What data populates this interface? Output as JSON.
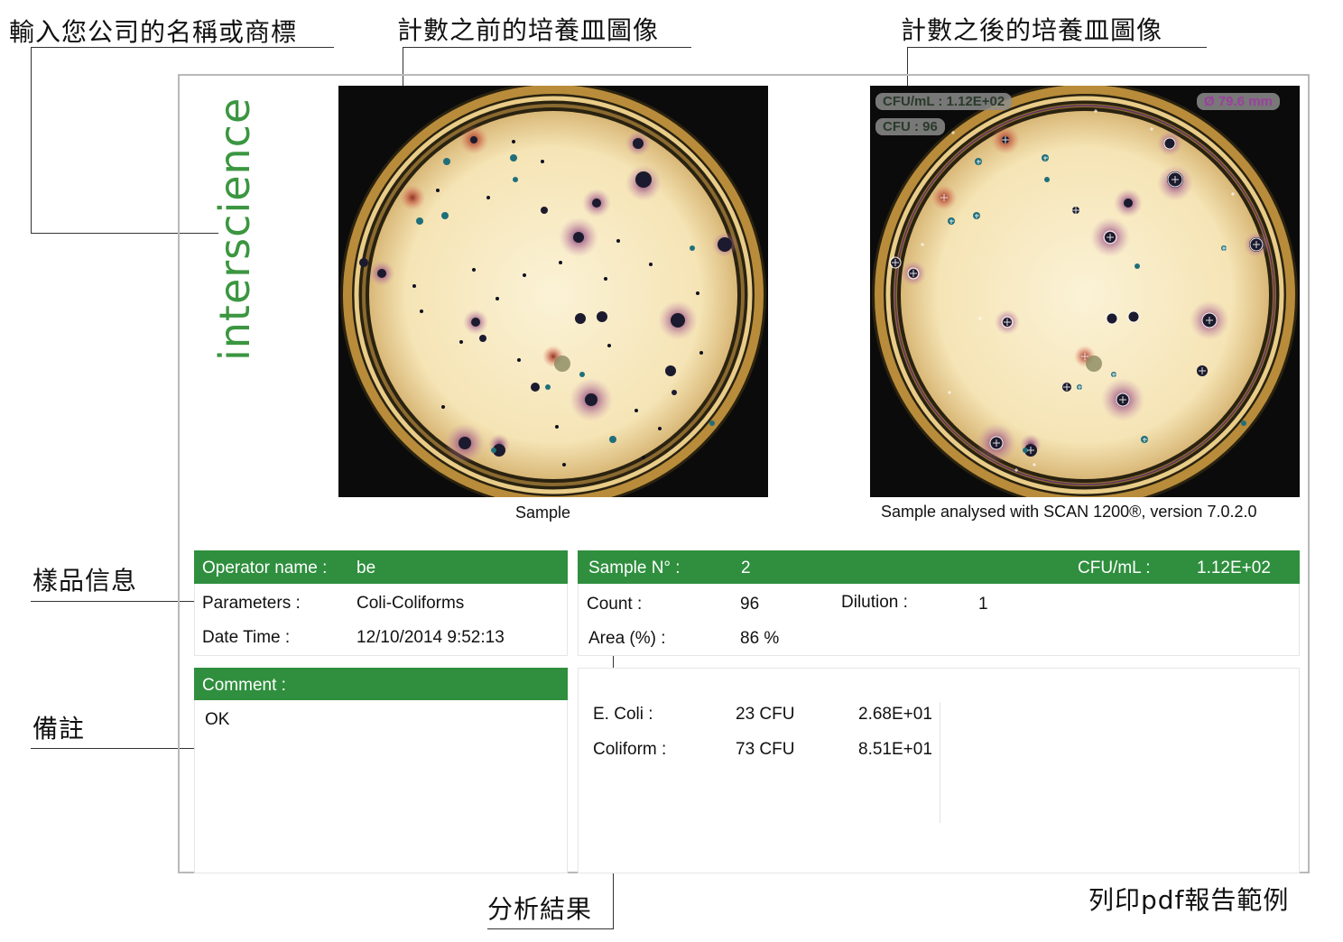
{
  "callouts": {
    "logo": "輸入您公司的名稱或商標",
    "before": "計數之前的培養皿圖像",
    "after": "計數之後的培養皿圖像",
    "sample_info": "樣品信息",
    "comment": "備註",
    "results": "分析結果",
    "footer": "列印pdf報告範例"
  },
  "logo_text": "interscience",
  "image_before": {
    "caption": "Sample"
  },
  "image_after": {
    "caption": "Sample analysed with SCAN 1200®, version 7.0.2.0",
    "badge_cfu_ml": "CFU/mL : 1.12E+02",
    "badge_cfu": "CFU : 96",
    "badge_diameter": "Ø 79.6 mm"
  },
  "left_panel": {
    "operator_label": "Operator name :",
    "operator_value": "be",
    "parameters_label": "Parameters :",
    "parameters_value": "Coli-Coliforms",
    "datetime_label": "Date Time :",
    "datetime_value": "12/10/2014 9:52:13"
  },
  "right_panel": {
    "sample_label": "Sample N° :",
    "sample_value": "2",
    "cfu_ml_label": "CFU/mL :",
    "cfu_ml_value": "1.12E+02",
    "count_label": "Count :",
    "count_value": "96",
    "dilution_label": "Dilution :",
    "dilution_value": "1",
    "area_label": "Area (%) :",
    "area_value": "86 %"
  },
  "comment": {
    "label": "Comment :",
    "value": "OK"
  },
  "results": [
    {
      "name": "E. Coli :",
      "cfu": "23 CFU",
      "value": "2.68E+01"
    },
    {
      "name": "Coliform :",
      "cfu": "73 CFU",
      "value": "8.51E+01"
    }
  ],
  "colors": {
    "brand_green": "#2f8f3e",
    "logo_green": "#3b9640",
    "frame_gray": "#b9b9b9",
    "agar": "#f6e8c0",
    "colony_blue": "#1f2f6e",
    "colony_purple": "#8c4a7a",
    "colony_red": "#b53a2a",
    "colony_teal": "#2d8a8a"
  }
}
